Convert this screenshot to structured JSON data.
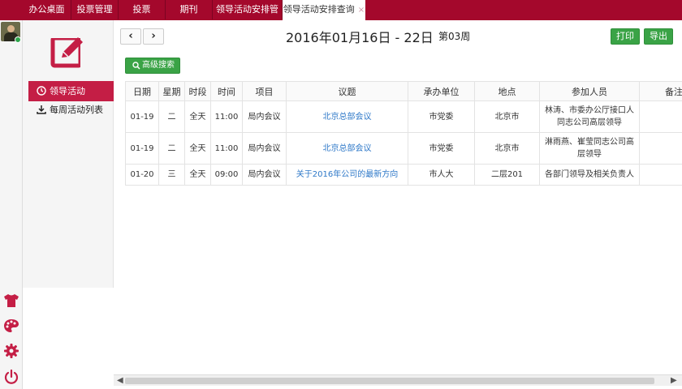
{
  "tabs": [
    {
      "label": "办公桌面"
    },
    {
      "label": "投票管理"
    },
    {
      "label": "投票"
    },
    {
      "label": "期刊"
    },
    {
      "label": "领导活动安排管理"
    },
    {
      "label": "领导活动安排查询",
      "close": "×"
    }
  ],
  "sidebar": {
    "items": [
      {
        "label": "领导活动"
      },
      {
        "label": "每周活动列表"
      }
    ]
  },
  "header": {
    "prev": "‹",
    "next": "›",
    "date_range": "2016年01月16日 - 22日",
    "week": "第03周",
    "print_label": "打印",
    "export_label": "导出",
    "search_label": "高级搜索"
  },
  "table": {
    "columns": [
      "日期",
      "星期",
      "时段",
      "时间",
      "项目",
      "议题",
      "承办单位",
      "地点",
      "参加人员",
      "备注"
    ],
    "rows": [
      {
        "date": "01-19",
        "weekday": "二",
        "period": "全天",
        "time": "11:00",
        "item": "局内会议",
        "topic": "北京总部会议",
        "org": "市党委",
        "place": "北京市",
        "people": "林涛、市委办公厅接口人同志公司高层领导",
        "note": ""
      },
      {
        "date": "01-19",
        "weekday": "二",
        "period": "全天",
        "time": "11:00",
        "item": "局内会议",
        "topic": "北京总部会议",
        "org": "市党委",
        "place": "北京市",
        "people": "淋雨燕、崔莹同志公司高层领导",
        "note": ""
      },
      {
        "date": "01-20",
        "weekday": "三",
        "period": "全天",
        "time": "09:00",
        "item": "局内会议",
        "topic": "关于2016年公司的最新方向",
        "org": "市人大",
        "place": "二层201",
        "people": "各部门领导及相关负责人",
        "note": ""
      }
    ]
  },
  "colors": {
    "brand": "#a4082c",
    "accent": "#c41e45",
    "green": "#3aa346",
    "link": "#2e78c8"
  },
  "icons": [
    "edit-icon",
    "clock-icon",
    "download-icon",
    "search-icon",
    "shirt-icon",
    "palette-icon",
    "gear-icon",
    "power-icon"
  ]
}
